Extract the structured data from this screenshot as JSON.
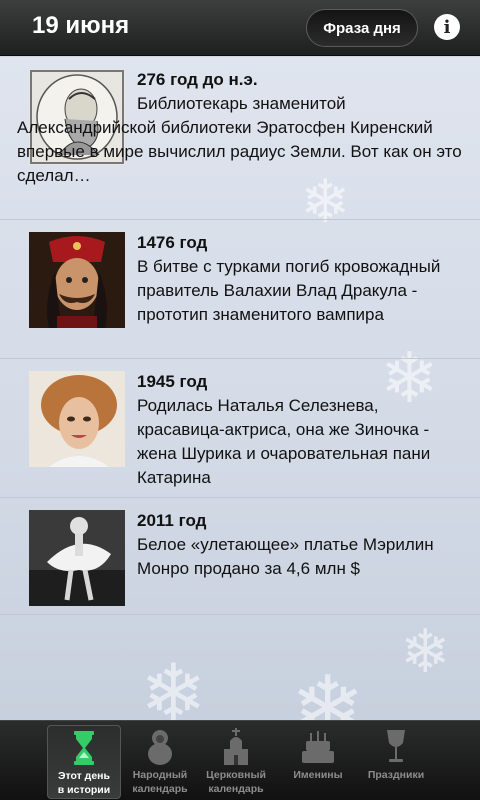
{
  "header": {
    "date": "19 июня",
    "phrase_button": "Фраза дня",
    "info_icon": "info-icon"
  },
  "events": [
    {
      "year": "276 год до н.э.",
      "text": "Библиотекарь знаменитой Александрийской библиотеки Эратосфен Киренский впервые в мире вычислил радиус Земли. Вот как он это сделал…",
      "image": "eratosthenes-engraving"
    },
    {
      "year": "1476 год",
      "text": "В битве с турками погиб кровожадный правитель Валахии Влад Дракула - прототип знаменитого вампира",
      "image": "vlad-dracula-portrait"
    },
    {
      "year": "1945 год",
      "text": "Родилась Наталья Селезнева, красавица-актриса, она же Зиночка - жена Шурика и очаровательная пани Катарина",
      "image": "natalya-selezneva-photo"
    },
    {
      "year": "2011 год",
      "text": "Белое «улетающее» платье Мэрилин Монро продано за 4,6 млн $",
      "image": "marilyn-monroe-photo"
    }
  ],
  "tabs": [
    {
      "label": "Этот день\nв истории",
      "icon": "hourglass-icon",
      "active": true
    },
    {
      "label": "Народный\nкалендарь",
      "icon": "matryoshka-icon",
      "active": false
    },
    {
      "label": "Церковный\nкалендарь",
      "icon": "church-icon",
      "active": false
    },
    {
      "label": "Именины",
      "icon": "cake-icon",
      "active": false
    },
    {
      "label": "Праздники",
      "icon": "goblet-icon",
      "active": false
    }
  ],
  "colors": {
    "header_bg": "#2a2b2b",
    "content_bg": "#d7dde8",
    "active_icon": "#33cc66",
    "inactive_icon": "#6b6b6b"
  }
}
